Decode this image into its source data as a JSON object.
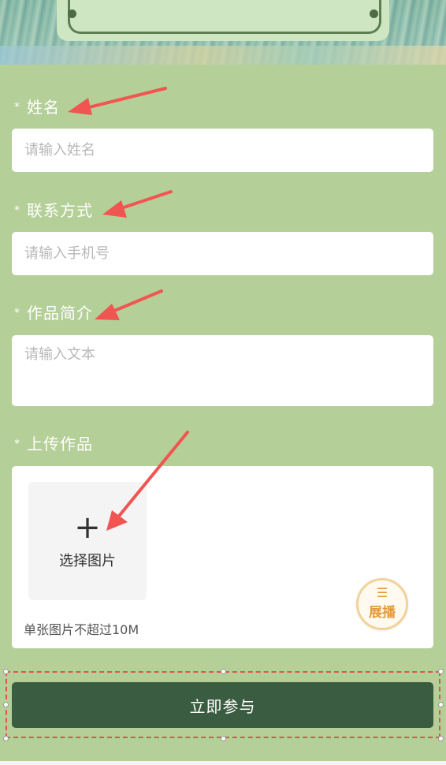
{
  "form": {
    "name": {
      "label": "姓名",
      "required_mark": "*",
      "placeholder": "请输入姓名",
      "value": ""
    },
    "contact": {
      "label": "联系方式",
      "required_mark": "*",
      "placeholder": "请输入手机号",
      "value": ""
    },
    "intro": {
      "label": "作品简介",
      "required_mark": "*",
      "placeholder": "请输入文本",
      "value": ""
    },
    "upload": {
      "label": "上传作品",
      "required_mark": "*",
      "plus_glyph": "+",
      "picker_label": "选择图片",
      "hint": "单张图片不超过10M"
    },
    "submit_label": "立即参与"
  },
  "float_button": {
    "icon": "menu-icon",
    "glyph": "☰",
    "label": "展播"
  },
  "colors": {
    "page_bg": "#b5cf98",
    "submit_bg": "#3a5c40",
    "annotation_red": "#f05552",
    "float_accent": "#e39a3b"
  }
}
